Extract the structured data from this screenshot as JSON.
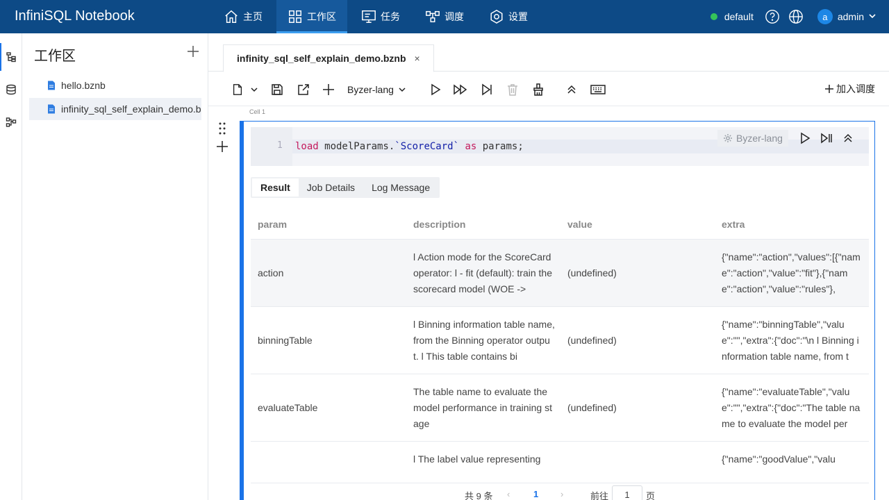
{
  "app": {
    "title": "InfiniSQL Notebook"
  },
  "nav": {
    "items": [
      {
        "label": "主页",
        "icon": "home-icon"
      },
      {
        "label": "工作区",
        "icon": "grid-icon",
        "active": true
      },
      {
        "label": "任务",
        "icon": "monitor-icon"
      },
      {
        "label": "调度",
        "icon": "flow-icon"
      },
      {
        "label": "设置",
        "icon": "settings-icon"
      }
    ]
  },
  "topright": {
    "env": "default",
    "user_initial": "a",
    "user": "admin",
    "status_color": "#35c35a"
  },
  "sidebar": {
    "title": "工作区",
    "files": [
      {
        "name": "hello.bznb"
      },
      {
        "name": "infinity_sql_self_explain_demo.bznb",
        "active": true
      }
    ]
  },
  "editor_tab": {
    "label": "infinity_sql_self_explain_demo.bznb",
    "close": "×"
  },
  "toolbar": {
    "language": "Byzer-lang",
    "schedule_label": "加入调度"
  },
  "cell": {
    "label": "Cell 1",
    "line_number": "1",
    "code": {
      "kw_load": "load",
      "ident": " modelParams.",
      "str_table": "`ScoreCard`",
      "kw_as": " as",
      "tail": " params;"
    },
    "language_chip": "Byzer-lang"
  },
  "result": {
    "tabs": [
      "Result",
      "Job Details",
      "Log Message"
    ],
    "columns": [
      "param",
      "description",
      "value",
      "extra"
    ],
    "rows": [
      {
        "param": "action",
        "description": "l Action mode for the ScoreCard operator: l - fit (default): train the scorecard model (WOE ->",
        "value": "(undefined)",
        "extra": "{\"name\":\"action\",\"values\":[{\"name\":\"action\",\"value\":\"fit\"},{\"name\":\"action\",\"value\":\"rules\"},"
      },
      {
        "param": "binningTable",
        "description": "l Binning information table name, from the Binning operator output. l This table contains bi",
        "value": "(undefined)",
        "extra": "{\"name\":\"binningTable\",\"value\":\"\",\"extra\":{\"doc\":\"\\n l Binning information table name, from t"
      },
      {
        "param": "evaluateTable",
        "description": "The table name to evaluate the model performance in training stage",
        "value": "(undefined)",
        "extra": "{\"name\":\"evaluateTable\",\"value\":\"\",\"extra\":{\"doc\":\"The table name to evaluate the model per"
      },
      {
        "param": "",
        "description": "l The label value representing",
        "value": "",
        "extra": "{\"name\":\"goodValue\",\"valu"
      }
    ]
  },
  "pagination": {
    "total": "共 9 条",
    "prev": "‹",
    "page": "1",
    "next": "›",
    "goto": "前往",
    "jump_value": "1",
    "unit": "页"
  }
}
